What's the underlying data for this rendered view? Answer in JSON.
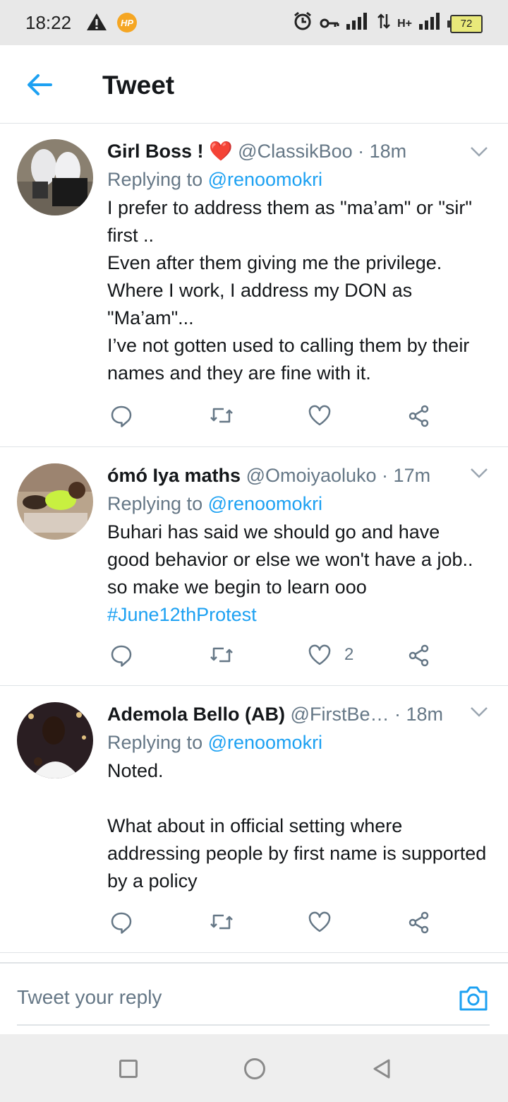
{
  "status_bar": {
    "time": "18:22",
    "battery": "72",
    "network": "H+"
  },
  "header": {
    "title": "Tweet",
    "back_icon": "arrow-left-icon"
  },
  "tweets": [
    {
      "name": "Girl Boss ! ❤️",
      "handle": "@ClassikBoo · 18m",
      "replying_prefix": "Replying to ",
      "replying_to": "@renoomokri",
      "body": "I prefer to address them as \"ma’am\" or \"sir\" first ..\nEven after them giving me the privilege.\nWhere I work, I address my DON as \"Ma’am\"...\nI’ve not gotten used to calling them by their names and they are fine with it.",
      "likes": ""
    },
    {
      "name": "ómó Iya maths",
      "handle": "@Omoiyaoluko · 17m",
      "replying_prefix": "Replying to ",
      "replying_to": "@renoomokri",
      "body": "Buhari has said we should go and have good behavior or else we won't have a job.. so make we begin to learn ooo",
      "hashtag": "#June12thProtest",
      "likes": "2"
    },
    {
      "name": "Ademola Bello (AB)",
      "handle": "@FirstBe… · 18m",
      "replying_prefix": "Replying to ",
      "replying_to": "@renoomokri",
      "body": "Noted.\n\nWhat about in official setting where addressing people by first name is supported by a policy",
      "likes": ""
    }
  ],
  "reply_bar": {
    "placeholder": "Tweet your reply"
  },
  "colors": {
    "accent": "#1da1f2",
    "secondary_text": "#657786",
    "divider": "#dfe3e6"
  }
}
